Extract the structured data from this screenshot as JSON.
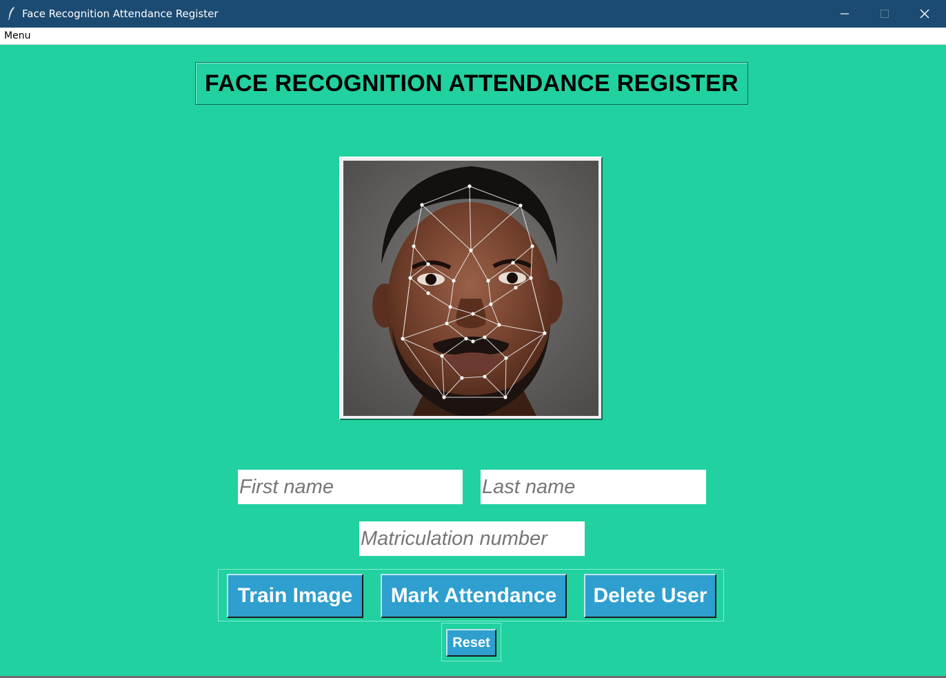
{
  "window": {
    "title": "Face Recognition Attendance Register",
    "icon": "feather-icon",
    "controls": [
      "minimize-icon",
      "maximize-icon",
      "close-icon"
    ]
  },
  "menubar": {
    "menu_label": "Menu"
  },
  "main": {
    "heading": "FACE RECOGNITION ATTENDANCE REGISTER",
    "image": "face-mesh-photo",
    "form": {
      "first_name_placeholder": "First name",
      "last_name_placeholder": "Last name",
      "matric_placeholder": "Matriculation number"
    },
    "buttons": {
      "train_image": "Train Image",
      "mark_attendance": "Mark Attendance",
      "delete_user": "Delete User",
      "reset": "Reset"
    }
  },
  "colors": {
    "background": "#22d1a0",
    "titlebar": "#1b4b72",
    "button": "#2e9fcf"
  }
}
